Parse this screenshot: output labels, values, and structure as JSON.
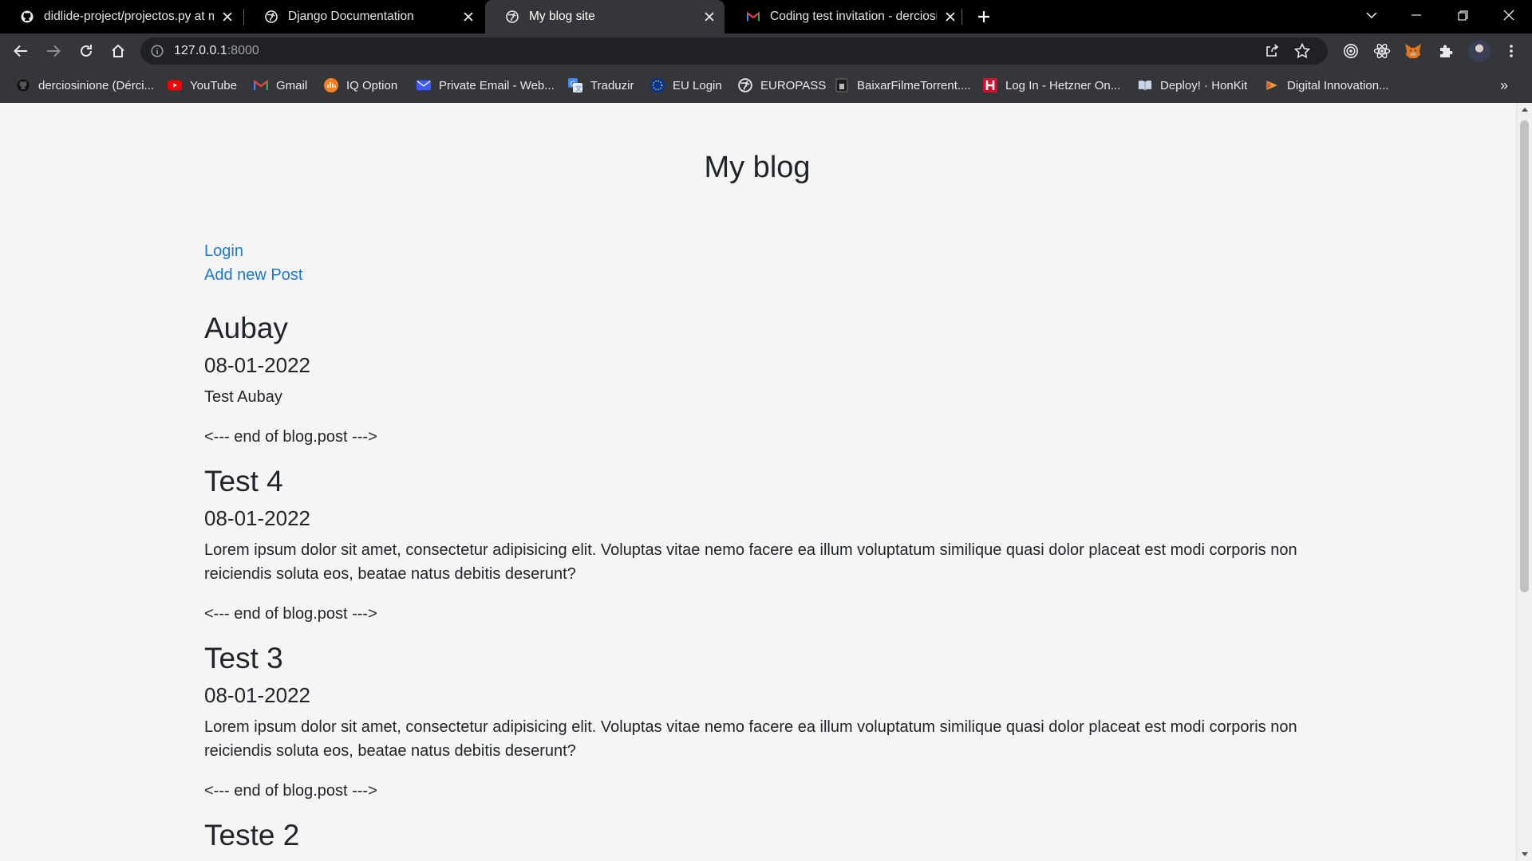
{
  "browser": {
    "tabs": [
      {
        "title": "didlide-project/projectos.py at m",
        "favicon": "github-icon",
        "active": false
      },
      {
        "title": "Django Documentation",
        "favicon": "globe-icon",
        "active": false
      },
      {
        "title": "My blog site",
        "favicon": "globe-icon",
        "active": true
      },
      {
        "title": "Coding test invitation - derciosin",
        "favicon": "gmail-icon",
        "active": false
      }
    ],
    "url": {
      "host": "127.0.0.1",
      "port": ":8000"
    },
    "bookmarks": [
      {
        "label": "derciosinione (Dérci...",
        "icon": "github-icon"
      },
      {
        "label": "YouTube",
        "icon": "youtube-icon"
      },
      {
        "label": "Gmail",
        "icon": "gmail-icon"
      },
      {
        "label": "IQ Option",
        "icon": "iq-option-icon"
      },
      {
        "label": "Private Email - Web...",
        "icon": "mail-icon"
      },
      {
        "label": "Traduzir",
        "icon": "translate-icon"
      },
      {
        "label": "EU Login",
        "icon": "eu-icon"
      },
      {
        "label": "EUROPASS",
        "icon": "globe-icon"
      },
      {
        "label": "BaixarFilmeTorrent....",
        "icon": "film-icon"
      },
      {
        "label": "Log In - Hetzner On...",
        "icon": "hetzner-icon"
      },
      {
        "label": "Deploy! · HonKit",
        "icon": "book-icon"
      },
      {
        "label": "Digital Innovation...",
        "icon": "dio-icon"
      }
    ],
    "bookmarks_more": "»",
    "colors": {
      "tab_strip": "#000000",
      "toolbar": "#35363a",
      "omnibox": "#202124",
      "link": "#1a78d6"
    }
  },
  "page": {
    "title": "My blog",
    "login_link": "Login",
    "add_post_link": "Add new Post",
    "posts": [
      {
        "title": "Aubay",
        "date": "08-01-2022",
        "text": "Test Aubay",
        "end": "<--- end of blog.post --->"
      },
      {
        "title": "Test 4",
        "date": "08-01-2022",
        "text": "Lorem ipsum dolor sit amet, consectetur adipisicing elit. Voluptas vitae nemo facere ea illum voluptatum similique quasi dolor placeat est modi corporis non reiciendis soluta eos, beatae natus debitis deserunt?",
        "end": "<--- end of blog.post --->"
      },
      {
        "title": "Test 3",
        "date": "08-01-2022",
        "text": "Lorem ipsum dolor sit amet, consectetur adipisicing elit. Voluptas vitae nemo facere ea illum voluptatum similique quasi dolor placeat est modi corporis non reiciendis soluta eos, beatae natus debitis deserunt?",
        "end": "<--- end of blog.post --->"
      },
      {
        "title": "Teste 2"
      }
    ]
  }
}
